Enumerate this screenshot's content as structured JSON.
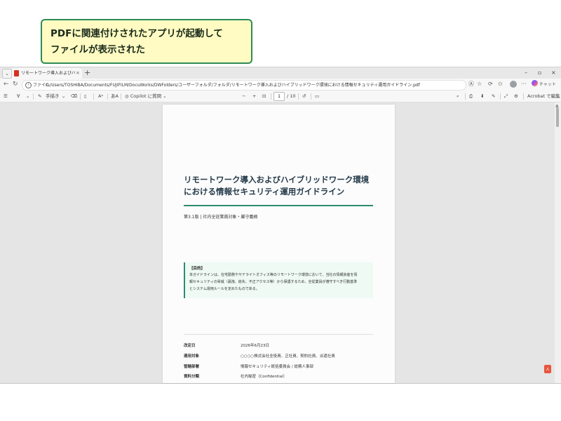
{
  "callout": {
    "line1": "PDFに関連付けされたアプリが起動して",
    "line2": "ファイルが表示された"
  },
  "browser": {
    "tab_title": "リモートワーク導入およびハイブリッドワーク環境における情報セキュリティ運用ガイドライン.pdf",
    "tab_close": "×",
    "new_tab": "+",
    "window_controls": {
      "minimize": "–",
      "restore": "▫",
      "close": "×"
    },
    "address": {
      "label": "ファイル",
      "url": "C:/Users/TOSHIBA/Documents/FUJIFILM/DocuWorks/DWFolders/ユーザーフォルダ/フォルダ/リモートワーク導入およびハイブリッドワーク環境における情報セキュリティ運用ガイドライン.pdf"
    },
    "chat_label": "チャット",
    "more": "···"
  },
  "pdf_toolbar": {
    "draw_label": "手描き",
    "copilot_label": "Copilot に質問",
    "zoom_out": "−",
    "zoom_in": "+",
    "current_page": "1",
    "total_pages": "/ 10",
    "acrobat_label": "Acrobat で編集"
  },
  "document": {
    "title_line1": "リモートワーク導入およびハイブリッドワーク環境",
    "title_line2": "における情報セキュリティ運用ガイドライン",
    "subtitle": "第3.1版 | 社内全従業員対象・厳守義務",
    "purpose_heading": "【目的】",
    "purpose_lines": [
      "本ガイドラインは、在宅勤務やサテライトオフィス等のリモートワーク環境において、当社の情報資産を情",
      "報セキュリティの脅威（漏洩、紛失、不正アクセス等）から保護するため、全従業員が遵守すべき行動基準",
      "とシステム運用ルールを定めたものである。"
    ],
    "meta": [
      {
        "key": "改定日",
        "value": "2026年6月23日"
      },
      {
        "key": "適用対象",
        "value": "○○○○株式会社全役員、正社員、契約社員、派遣社員"
      },
      {
        "key": "管轄部署",
        "value": "情報セキュリティ統括委員会 / 総務人事部"
      },
      {
        "key": "資料分類",
        "value": "社内秘密（Confidential）"
      }
    ]
  },
  "icons": {
    "menu": "menu-icon",
    "back": "back-icon",
    "refresh": "refresh-icon",
    "pdf_app": "pdf-app-icon",
    "adobe": "adobe-acrobat-icon"
  }
}
